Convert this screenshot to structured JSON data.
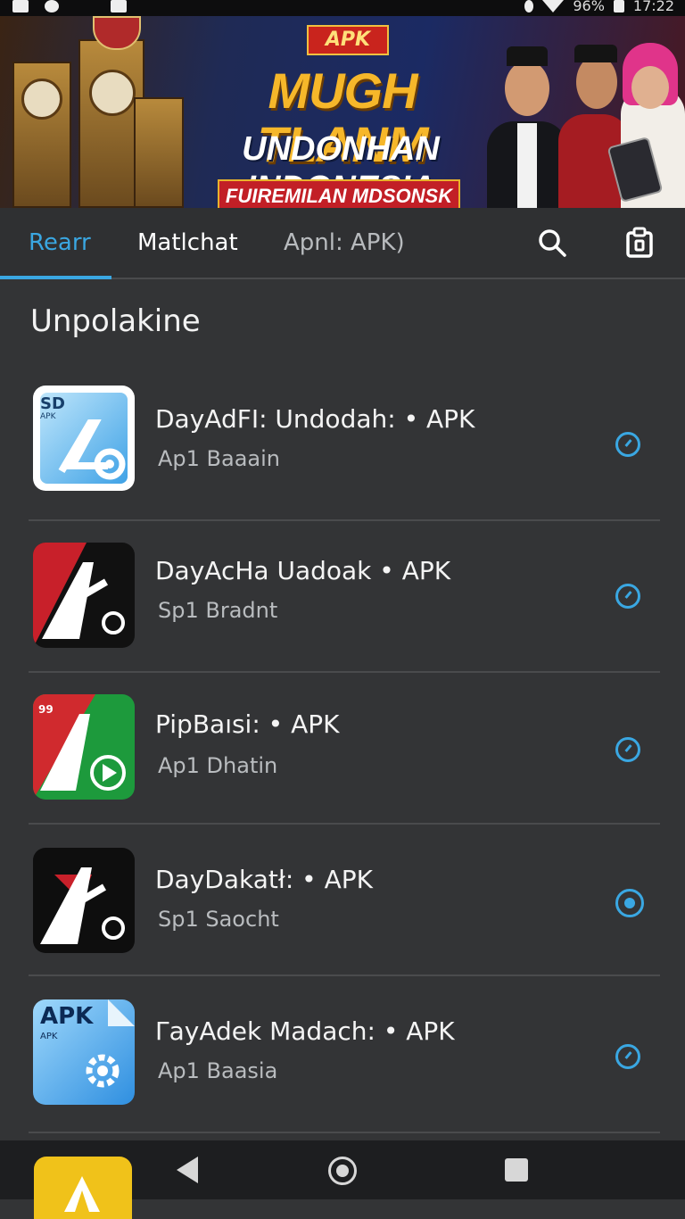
{
  "status_bar": {
    "battery": "96%",
    "time": "17:22"
  },
  "banner": {
    "tag": "APK",
    "title": "MUGH TLANM",
    "subtitle": "UNDONHAN INDONESIA",
    "ribbon": "FUIREMILAN MDSONSK"
  },
  "tabs": [
    {
      "label": "Rearr",
      "active": true
    },
    {
      "label": "Matlchat",
      "active": false
    },
    {
      "label": "Apnl: APK)",
      "active": false
    }
  ],
  "toolbar": {
    "search_icon": "search-icon",
    "clipboard_icon": "clipboard-icon"
  },
  "section": {
    "title": "Unpolakine"
  },
  "apps": [
    {
      "name": "DayAdFI: Undodah: • APK",
      "sub": "Ap1 Baaain",
      "icon_text": "SD",
      "icon_small": "APK",
      "selected": false
    },
    {
      "name": "DayAcHa Uadoak • APK",
      "sub": "Sp1 Bradnt",
      "icon_text": "A",
      "icon_small": "",
      "selected": false
    },
    {
      "name": "PipBaısi: • APK",
      "sub": "Ap1 Dhatin",
      "icon_text": "A",
      "icon_small": "99",
      "selected": false
    },
    {
      "name": "DayDakatł: • APK",
      "sub": "Sp1 Saocht",
      "icon_text": "A",
      "icon_small": "",
      "selected": true
    },
    {
      "name": "ΓayAdek Madach: • APK",
      "sub": "Ap1 Baasia",
      "icon_text": "APK",
      "icon_small": "APK",
      "selected": false
    }
  ],
  "colors": {
    "accent": "#3aa7e2",
    "background": "#333436"
  }
}
